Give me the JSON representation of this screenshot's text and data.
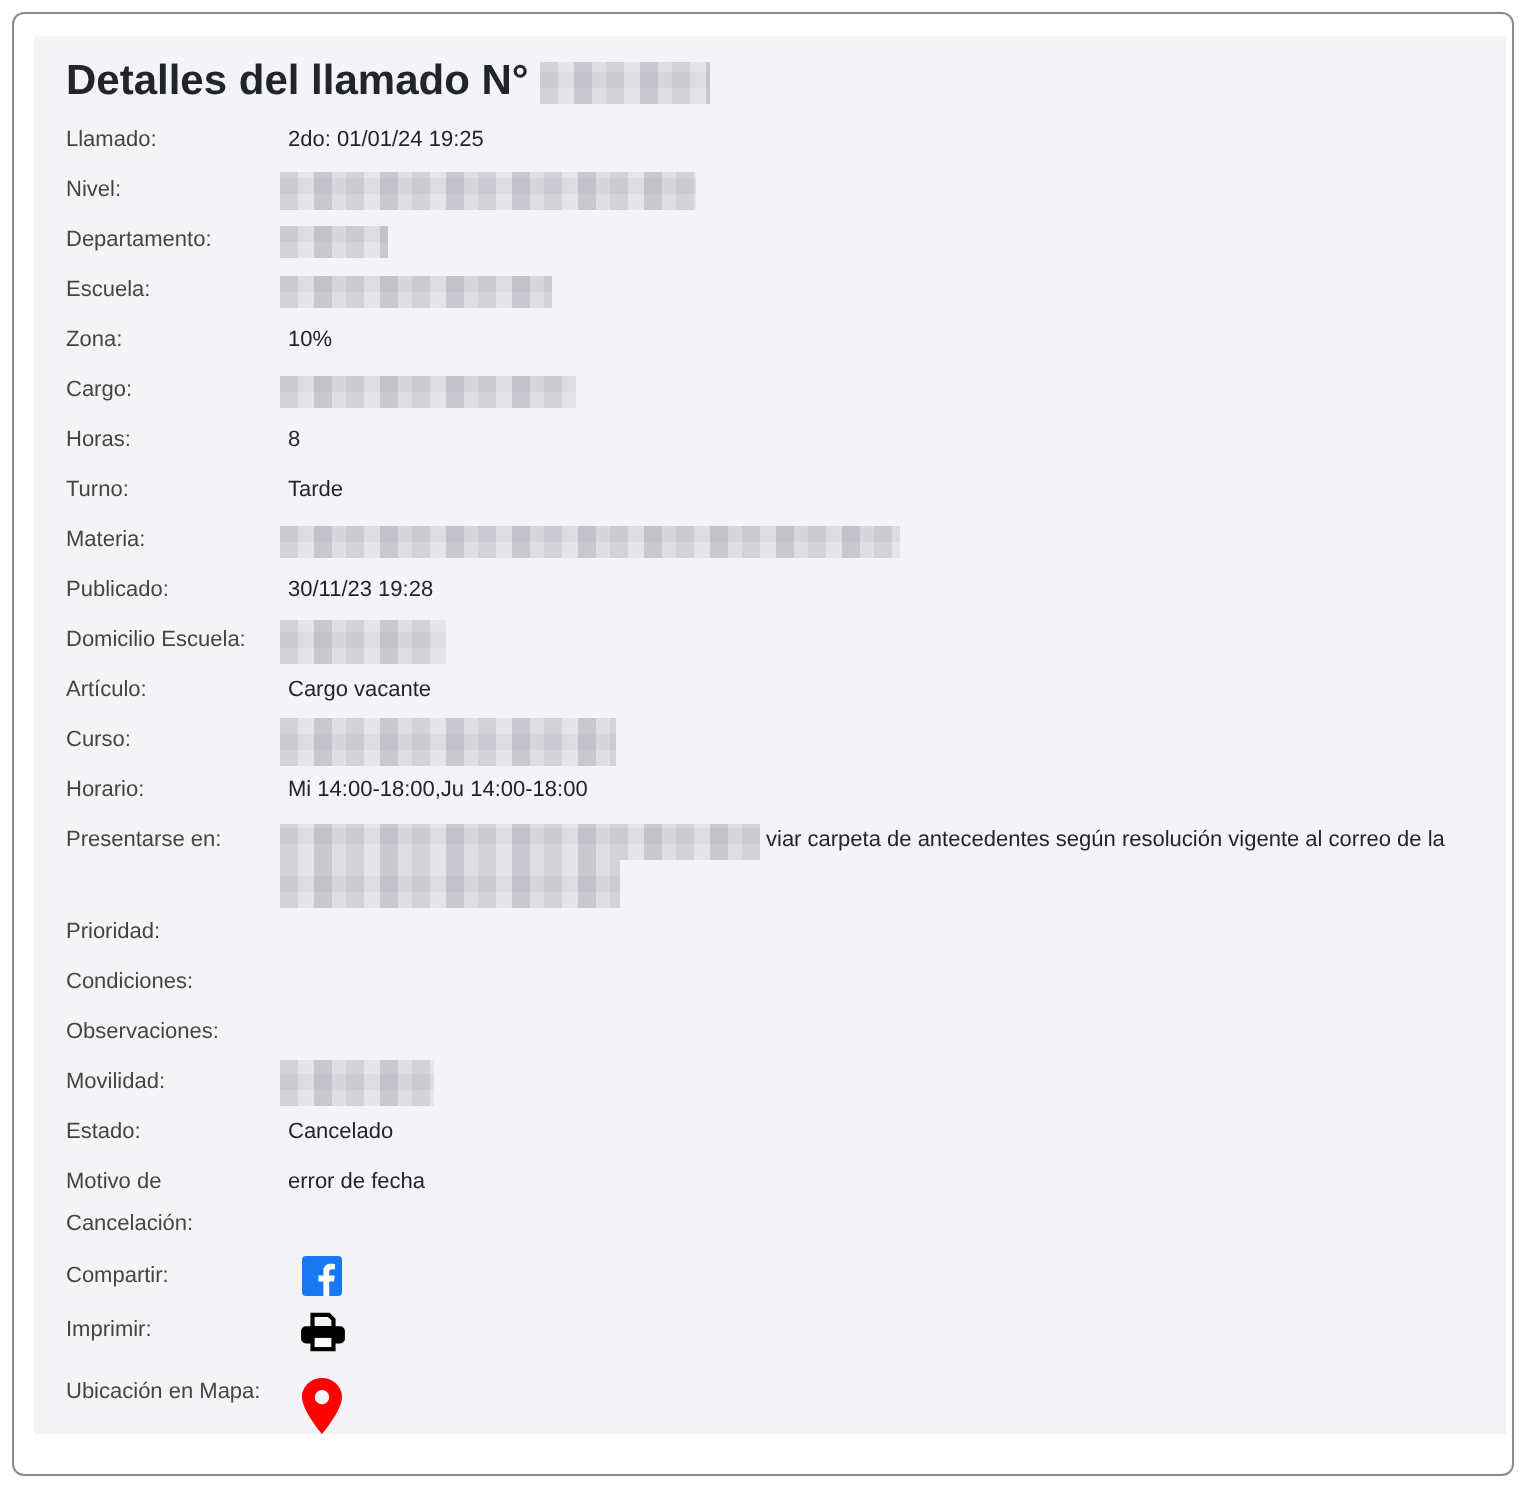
{
  "title": {
    "text": "Detalles del llamado N°",
    "number_redacted": true
  },
  "fields": [
    {
      "label": "Llamado:",
      "kind": "text",
      "value": "2do: 01/01/24 19:25"
    },
    {
      "label": "Nivel:",
      "kind": "redacted"
    },
    {
      "label": "Departamento:",
      "kind": "redacted"
    },
    {
      "label": "Escuela:",
      "kind": "redacted"
    },
    {
      "label": "Zona:",
      "kind": "text",
      "value": "10%"
    },
    {
      "label": "Cargo:",
      "kind": "redacted"
    },
    {
      "label": "Horas:",
      "kind": "text",
      "value": "8"
    },
    {
      "label": "Turno:",
      "kind": "text",
      "value": "Tarde"
    },
    {
      "label": "Materia:",
      "kind": "redacted"
    },
    {
      "label": "Publicado:",
      "kind": "text",
      "value": "30/11/23 19:28"
    },
    {
      "label": "Domicilio Escuela:",
      "kind": "redacted"
    },
    {
      "label": "Artículo:",
      "kind": "text",
      "value": "Cargo vacante"
    },
    {
      "label": "Curso:",
      "kind": "redacted"
    },
    {
      "label": "Horario:",
      "kind": "text",
      "value": "Mi 14:00-18:00,Ju 14:00-18:00"
    },
    {
      "label": "Presentarse en:",
      "kind": "partly_redacted",
      "value": "viar carpeta de antecedentes según resolución vigente al correo de la"
    },
    {
      "label": "Prioridad:",
      "kind": "empty"
    },
    {
      "label": "Condiciones:",
      "kind": "empty"
    },
    {
      "label": "Observaciones:",
      "kind": "empty"
    },
    {
      "label": "Movilidad:",
      "kind": "redacted"
    },
    {
      "label": "Estado:",
      "kind": "text",
      "value": "Cancelado"
    },
    {
      "label": "Motivo de Cancelación:",
      "kind": "text",
      "value": "error de fecha"
    },
    {
      "label": "Compartir:",
      "kind": "share"
    },
    {
      "label": "Imprimir:",
      "kind": "print"
    },
    {
      "label": "Ubicación en Mapa:",
      "kind": "map"
    }
  ]
}
